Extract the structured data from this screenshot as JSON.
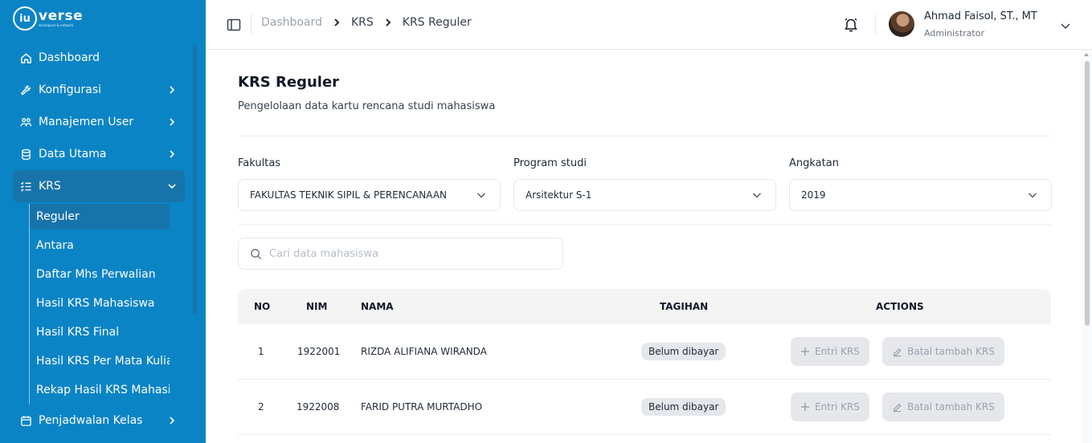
{
  "brand": {
    "mark": "iu",
    "name": "verse",
    "tagline": "workspace & network"
  },
  "sidebar": {
    "items": [
      {
        "label": "Dashboard",
        "icon": "home-icon"
      },
      {
        "label": "Konfigurasi",
        "icon": "wrench-icon"
      },
      {
        "label": "Manajemen User",
        "icon": "users-icon"
      },
      {
        "label": "Data Utama",
        "icon": "database-icon"
      },
      {
        "label": "KRS",
        "icon": "list-check-icon"
      },
      {
        "label": "Penjadwalan Kelas",
        "icon": "calendar-icon"
      }
    ],
    "krs_sub": [
      "Reguler",
      "Antara",
      "Daftar Mhs Perwalian",
      "Hasil KRS Mahasiswa",
      "Hasil KRS Final",
      "Hasil KRS Per Mata Kuliah",
      "Rekap Hasil KRS Mahasiswa"
    ]
  },
  "header": {
    "breadcrumb": [
      "Dashboard",
      "KRS",
      "KRS Reguler"
    ],
    "user_name": "Ahmad Faisol, ST., MT",
    "user_role": "Administrator"
  },
  "page": {
    "title": "KRS Reguler",
    "subtitle": "Pengelolaan data kartu rencana studi mahasiswa"
  },
  "filters": {
    "fakultas_label": "Fakultas",
    "fakultas_value": "FAKULTAS TEKNIK SIPIL & PERENCANAAN",
    "prodi_label": "Program studi",
    "prodi_value": "Arsitektur S-1",
    "angkatan_label": "Angkatan",
    "angkatan_value": "2019"
  },
  "search": {
    "placeholder": "Cari data mahasiswa"
  },
  "table": {
    "headers": {
      "no": "NO",
      "nim": "NIM",
      "nama": "NAMA",
      "tagihan": "TAGIHAN",
      "actions": "ACTIONS"
    },
    "rows": [
      {
        "no": "1",
        "nim": "1922001",
        "nama": "RIZDA ALIFIANA WIRANDA",
        "tagihan": "Belum dibayar",
        "entri": "Entri KRS",
        "batal": "Batal tambah KRS"
      },
      {
        "no": "2",
        "nim": "1922008",
        "nama": "FARID PUTRA MURTADHO",
        "tagihan": "Belum dibayar",
        "entri": "Entri KRS",
        "batal": "Batal tambah KRS"
      }
    ]
  },
  "colors": {
    "sidebar": "#0b84c6",
    "active": "#1774ab",
    "badge": "#e5e7eb"
  }
}
